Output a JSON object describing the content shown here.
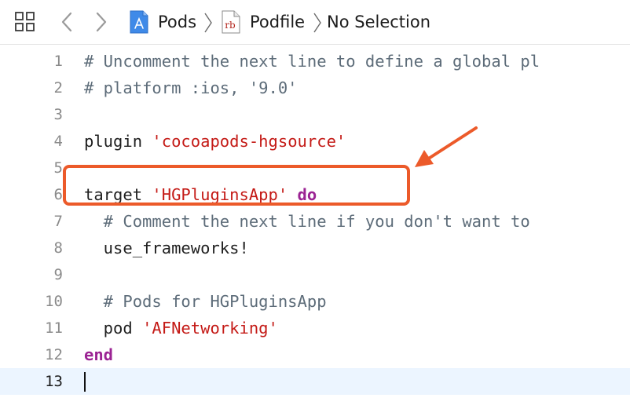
{
  "jumpbar": {
    "breadcrumbs": [
      {
        "label": "Pods",
        "icon": "xcode-project-icon"
      },
      {
        "label": "Podfile",
        "icon": "ruby-file-icon",
        "icon_text": "rb"
      },
      {
        "label": "No Selection"
      }
    ],
    "icons": [
      "related-items-grid-icon",
      "back-arrow-icon",
      "forward-arrow-icon",
      "chevron-right-icon"
    ]
  },
  "editor": {
    "lines": [
      {
        "num": "1",
        "tokens": [
          {
            "t": "# Uncomment the next line to define a global pl",
            "c": "comment"
          }
        ]
      },
      {
        "num": "2",
        "tokens": [
          {
            "t": "# platform :ios, '9.0'",
            "c": "comment"
          }
        ]
      },
      {
        "num": "3",
        "tokens": []
      },
      {
        "num": "4",
        "tokens": [
          {
            "t": "plugin ",
            "c": "plain"
          },
          {
            "t": "'cocoapods-hgsource'",
            "c": "string"
          }
        ]
      },
      {
        "num": "5",
        "tokens": []
      },
      {
        "num": "6",
        "tokens": [
          {
            "t": "target ",
            "c": "plain"
          },
          {
            "t": "'HGPluginsApp'",
            "c": "string"
          },
          {
            "t": " ",
            "c": "plain"
          },
          {
            "t": "do",
            "c": "kw"
          }
        ]
      },
      {
        "num": "7",
        "tokens": [
          {
            "t": "  # Comment the next line if you don't want to",
            "c": "comment"
          }
        ]
      },
      {
        "num": "8",
        "tokens": [
          {
            "t": "  use_frameworks!",
            "c": "plain"
          }
        ]
      },
      {
        "num": "9",
        "tokens": []
      },
      {
        "num": "10",
        "tokens": [
          {
            "t": "  # Pods for HGPluginsApp",
            "c": "comment"
          }
        ]
      },
      {
        "num": "11",
        "tokens": [
          {
            "t": "  pod ",
            "c": "plain"
          },
          {
            "t": "'AFNetworking'",
            "c": "string"
          }
        ]
      },
      {
        "num": "12",
        "tokens": [
          {
            "t": "end",
            "c": "kw"
          }
        ]
      },
      {
        "num": "13",
        "tokens": [],
        "current": true
      }
    ]
  },
  "colors": {
    "comment": "#5d6c79",
    "string": "#c41a16",
    "keyword": "#9b2393",
    "current_line": "#ecf5ff",
    "annotation": "#ec5a2a"
  }
}
